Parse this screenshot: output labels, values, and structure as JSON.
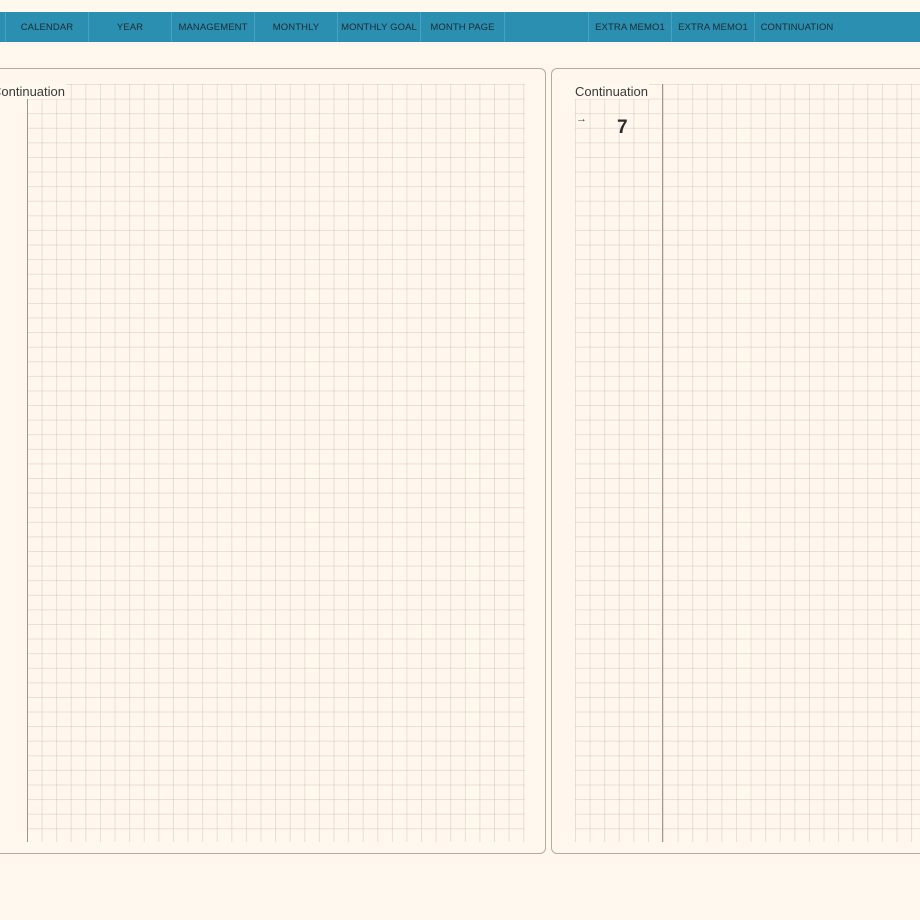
{
  "nav": {
    "tabs": [
      {
        "label": ""
      },
      {
        "label": "CALENDAR"
      },
      {
        "label": "YEAR"
      },
      {
        "label": "MANAGEMENT"
      },
      {
        "label": "MONTHLY"
      },
      {
        "label": "MONTHLY GOAL"
      },
      {
        "label": "MONTH PAGE"
      },
      {
        "label": ""
      },
      {
        "label": "EXTRA MEMO1"
      },
      {
        "label": "EXTRA MEMO1"
      },
      {
        "label": "CONTINUATION"
      }
    ]
  },
  "left_page": {
    "label": "Continuation"
  },
  "right_page": {
    "label": "Continuation",
    "arrow": "→",
    "page_number": "7"
  },
  "colors": {
    "topbar": "#2a8fb0",
    "background": "#fef8ee",
    "panel_border": "#b6ab9d"
  }
}
